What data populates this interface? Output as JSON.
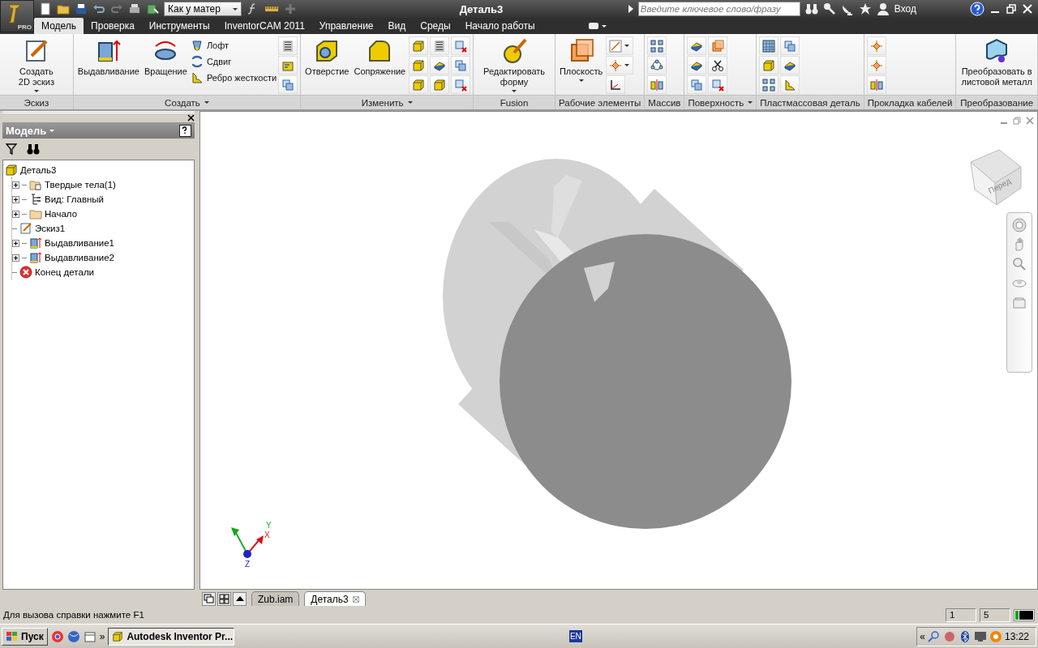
{
  "header": {
    "app_badge": "PRO",
    "style_dropdown": "Как у матер",
    "title": "Деталь3",
    "search_placeholder": "Введите ключевое слово/фразу",
    "sign_in": "Вход"
  },
  "ribbon_tabs": [
    {
      "label": "Модель",
      "selected": true
    },
    {
      "label": "Проверка",
      "selected": false
    },
    {
      "label": "Инструменты",
      "selected": false
    },
    {
      "label": "InventorCAM 2011",
      "selected": false
    },
    {
      "label": "Управление",
      "selected": false
    },
    {
      "label": "Вид",
      "selected": false
    },
    {
      "label": "Среды",
      "selected": false
    },
    {
      "label": "Начало работы",
      "selected": false
    }
  ],
  "ribbon_panels": [
    {
      "title": "Эскиз",
      "menu": false,
      "tools": [
        {
          "kind": "large",
          "label": "Создать 2D эскиз",
          "dropdown": true
        }
      ]
    },
    {
      "title": "Создать",
      "menu": true,
      "tools": [
        {
          "kind": "large",
          "label": "Выдавливание",
          "dropdown": false
        },
        {
          "kind": "large",
          "label": "Вращение",
          "dropdown": false
        },
        {
          "kind": "small",
          "label": "Лофт"
        },
        {
          "kind": "small",
          "label": "Сдвиг"
        },
        {
          "kind": "small",
          "label": "Ребро жесткости"
        }
      ]
    },
    {
      "title": "Изменить",
      "menu": true,
      "tools": [
        {
          "kind": "large",
          "label": "Отверстие",
          "dropdown": false
        },
        {
          "kind": "large",
          "label": "Сопряжение",
          "dropdown": false
        }
      ]
    },
    {
      "title": "Fusion",
      "menu": false,
      "tools": [
        {
          "kind": "large",
          "label": "Редактировать форму",
          "dropdown": true
        }
      ]
    },
    {
      "title": "Рабочие элементы",
      "menu": false,
      "tools": [
        {
          "kind": "large",
          "label": "Плоскость",
          "dropdown": true
        }
      ]
    },
    {
      "title": "Массив",
      "menu": false
    },
    {
      "title": "Поверхность",
      "menu": true
    },
    {
      "title": "Пластмассовая деталь",
      "menu": false
    },
    {
      "title": "Прокладка кабелей",
      "menu": false
    },
    {
      "title": "Преобразование",
      "menu": false,
      "tools": [
        {
          "kind": "large",
          "label": "Преобразовать в листовой металл",
          "dropdown": false
        }
      ]
    }
  ],
  "browser": {
    "title": "Модель",
    "tree": [
      {
        "label": "Деталь3",
        "kind": "part",
        "children": [
          {
            "label": "Твердые тела(1)",
            "kind": "solids",
            "collapsed": true
          },
          {
            "label": "Вид: Главный",
            "kind": "view",
            "collapsed": true
          },
          {
            "label": "Начало",
            "kind": "folder",
            "collapsed": true
          },
          {
            "label": "Эскиз1",
            "kind": "sketch",
            "collapsed": false
          },
          {
            "label": "Выдавливание1",
            "kind": "extrude",
            "collapsed": true
          },
          {
            "label": "Выдавливание2",
            "kind": "extrude",
            "collapsed": true
          },
          {
            "label": "Конец детали",
            "kind": "end",
            "collapsed": false
          }
        ]
      }
    ]
  },
  "viewport": {
    "view_cube_label": "Перед",
    "axes": {
      "x": "X",
      "y": "Y",
      "z": "Z"
    }
  },
  "document_tabs": [
    {
      "label": "Zub.iam",
      "selected": false
    },
    {
      "label": "Деталь3",
      "selected": true
    }
  ],
  "status_bar": {
    "text": "Для вызова справки нажмите F1",
    "fields": [
      "1",
      "5"
    ]
  },
  "taskbar": {
    "start": "Пуск",
    "more": "»",
    "tasks": [
      {
        "label": "Autodesk Inventor Pr...",
        "selected": true
      }
    ],
    "language": "EN",
    "tray_more": "«",
    "clock": "13:22"
  }
}
